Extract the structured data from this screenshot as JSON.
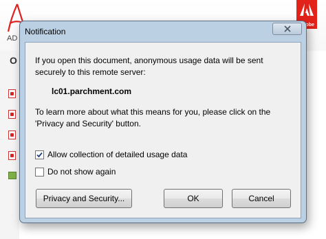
{
  "background": {
    "app_label": "AD",
    "open_letter": "O",
    "adobe_badge_text": "Adobe"
  },
  "dialog": {
    "title": "Notification",
    "message_line1": "If you open this document, anonymous usage data will be sent",
    "message_line2": "securely to this remote server:",
    "server": "lc01.parchment.com",
    "info_line1": "To learn more about what this means for you, please click on the",
    "info_line2": "'Privacy and Security' button.",
    "checkbox_allow": {
      "label": "Allow collection of detailed usage data",
      "checked": true
    },
    "checkbox_dontshow": {
      "label": "Do not show again",
      "checked": false
    },
    "buttons": {
      "privacy": "Privacy and Security...",
      "ok": "OK",
      "cancel": "Cancel"
    }
  },
  "colors": {
    "dialog_frame": "#bcd0e3",
    "adobe_red": "#e2231a"
  }
}
